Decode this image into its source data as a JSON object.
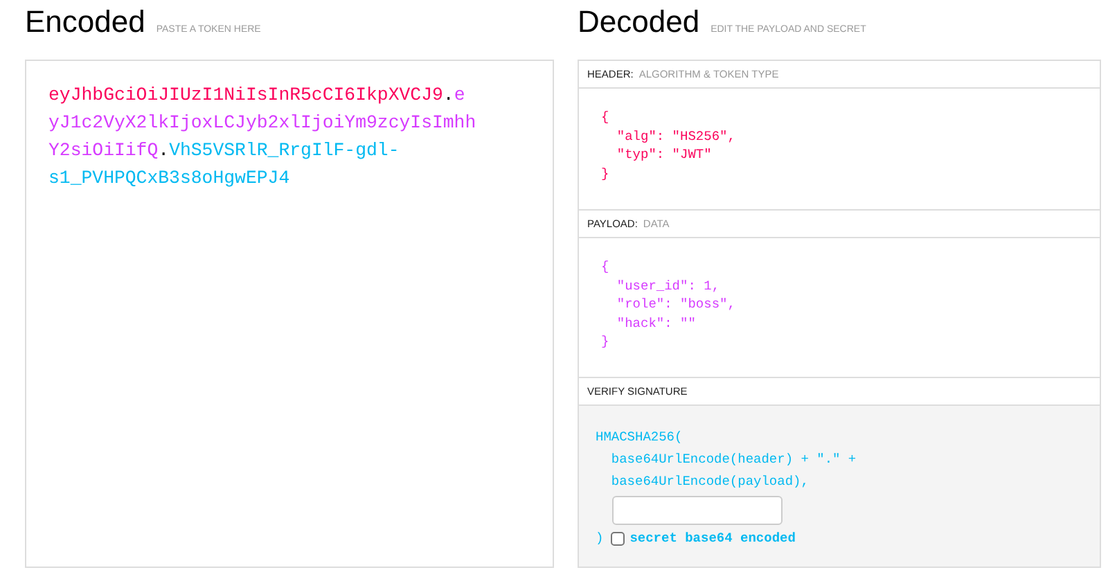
{
  "encoded": {
    "title": "Encoded",
    "hint": "PASTE A TOKEN HERE",
    "token": [
      {
        "kind": "header",
        "text": "eyJhbGciOiJIUzI1NiIsInR5cCI6IkpXVCJ9"
      },
      {
        "kind": "dot",
        "text": "."
      },
      {
        "kind": "payload",
        "text": "eyJ1c2VyX2lkIjoxLCJyb2xlIjoiYm9zcyIsImhhY2siOiIifQ"
      },
      {
        "kind": "dot",
        "text": "."
      },
      {
        "kind": "signature",
        "text": "VhS5VSRlR_RrgIlF-gdl-s1_PVHPQCxB3s8oHgwEPJ4"
      }
    ]
  },
  "decoded": {
    "title": "Decoded",
    "hint": "EDIT THE PAYLOAD AND SECRET",
    "sections": [
      {
        "kind": "header",
        "label": "HEADER:",
        "sublabel": "ALGORITHM & TOKEN TYPE",
        "lines": [
          "{",
          "  \"alg\": \"HS256\",",
          "  \"typ\": \"JWT\"",
          "}"
        ]
      },
      {
        "kind": "payload",
        "label": "PAYLOAD:",
        "sublabel": "DATA",
        "lines": [
          "{",
          "  \"user_id\": 1,",
          "  \"role\": \"boss\",",
          "  \"hack\": \"\"",
          "}"
        ]
      },
      {
        "kind": "signature",
        "label": "VERIFY SIGNATURE",
        "lines": [
          "HMACSHA256(",
          "  base64UrlEncode(header) + \".\" +",
          "  base64UrlEncode(payload),"
        ],
        "close": ")",
        "checkbox": {
          "label": "secret base64 encoded",
          "checked": false
        }
      }
    ]
  }
}
